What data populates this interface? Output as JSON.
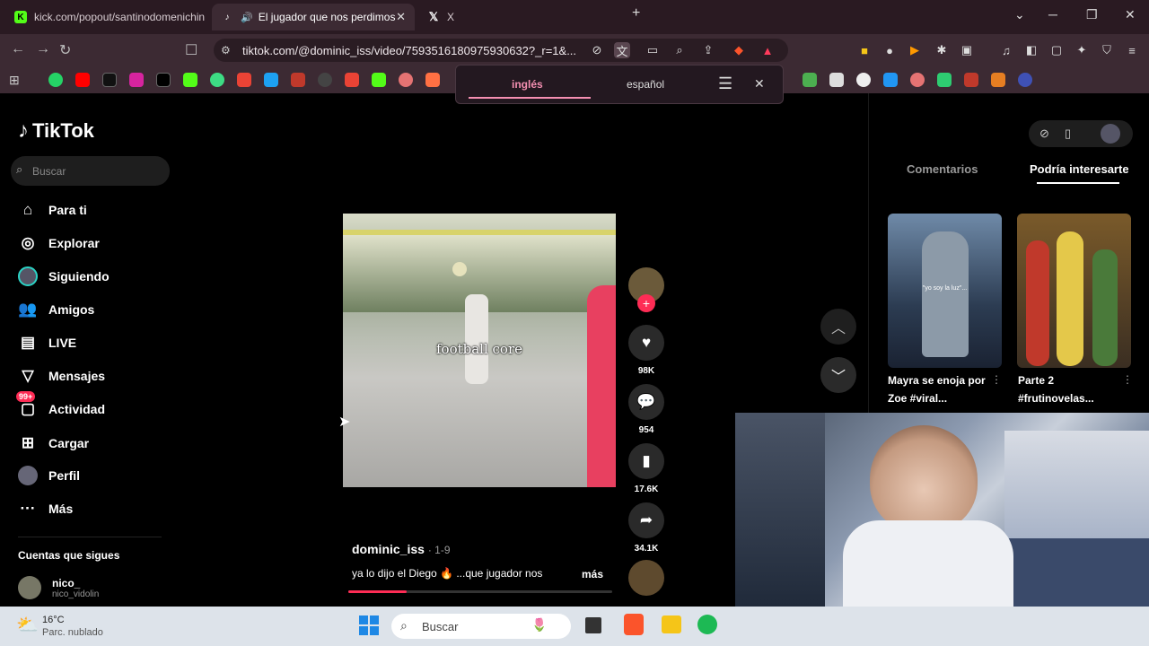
{
  "tabs": [
    {
      "label": "kick.com/popout/santinodomenichin"
    },
    {
      "label": "El jugador que nos perdimos"
    },
    {
      "label": "X"
    }
  ],
  "address": {
    "url": "tiktok.com/@dominic_iss/video/7593516180975930632?_r=1&..."
  },
  "translate": {
    "lang_from": "inglés",
    "lang_to": "español"
  },
  "tiktok": {
    "logo_text": "TikTok",
    "search_placeholder": "Buscar",
    "nav": [
      {
        "label": "Para ti",
        "icon": "home-icon"
      },
      {
        "label": "Explorar",
        "icon": "compass-icon"
      },
      {
        "label": "Siguiendo",
        "icon": "following-avatar"
      },
      {
        "label": "Amigos",
        "icon": "friends-icon"
      },
      {
        "label": "LIVE",
        "icon": "live-icon"
      },
      {
        "label": "Mensajes",
        "icon": "messages-icon"
      },
      {
        "label": "Actividad",
        "icon": "activity-icon",
        "badge": "99+"
      },
      {
        "label": "Cargar",
        "icon": "upload-icon"
      },
      {
        "label": "Perfil",
        "icon": "profile-avatar"
      },
      {
        "label": "Más",
        "icon": "more-icon"
      }
    ],
    "following_title": "Cuentas que sigues",
    "following_account": {
      "name": "nico_",
      "handle": "nico_vidolin"
    },
    "video": {
      "overlay_text": "football core",
      "author": "dominic_iss",
      "date": "· 1-9",
      "description": "ya lo dijo el Diego 🔥 ...que jugador nos",
      "more": "más",
      "progress": 0.22
    },
    "actions": {
      "likes": "98K",
      "comments": "954",
      "saves": "17.6K",
      "shares": "34.1K"
    },
    "right_tabs": {
      "comments": "Comentarios",
      "suggested": "Podría interesarte"
    },
    "suggested": [
      {
        "title": "Mayra se enoja por Zoe #viral...",
        "overlay": "\"yo soy la luz\"..."
      },
      {
        "title": "Parte 2 #frutinovelas..."
      }
    ]
  },
  "taskbar": {
    "temp": "16°C",
    "weather": "Parc. nublado",
    "search": "Buscar"
  },
  "colors": {
    "accent": "#fe2c55",
    "tab_bar": "#2a1a22",
    "translate_underline": "#f48fb1"
  }
}
